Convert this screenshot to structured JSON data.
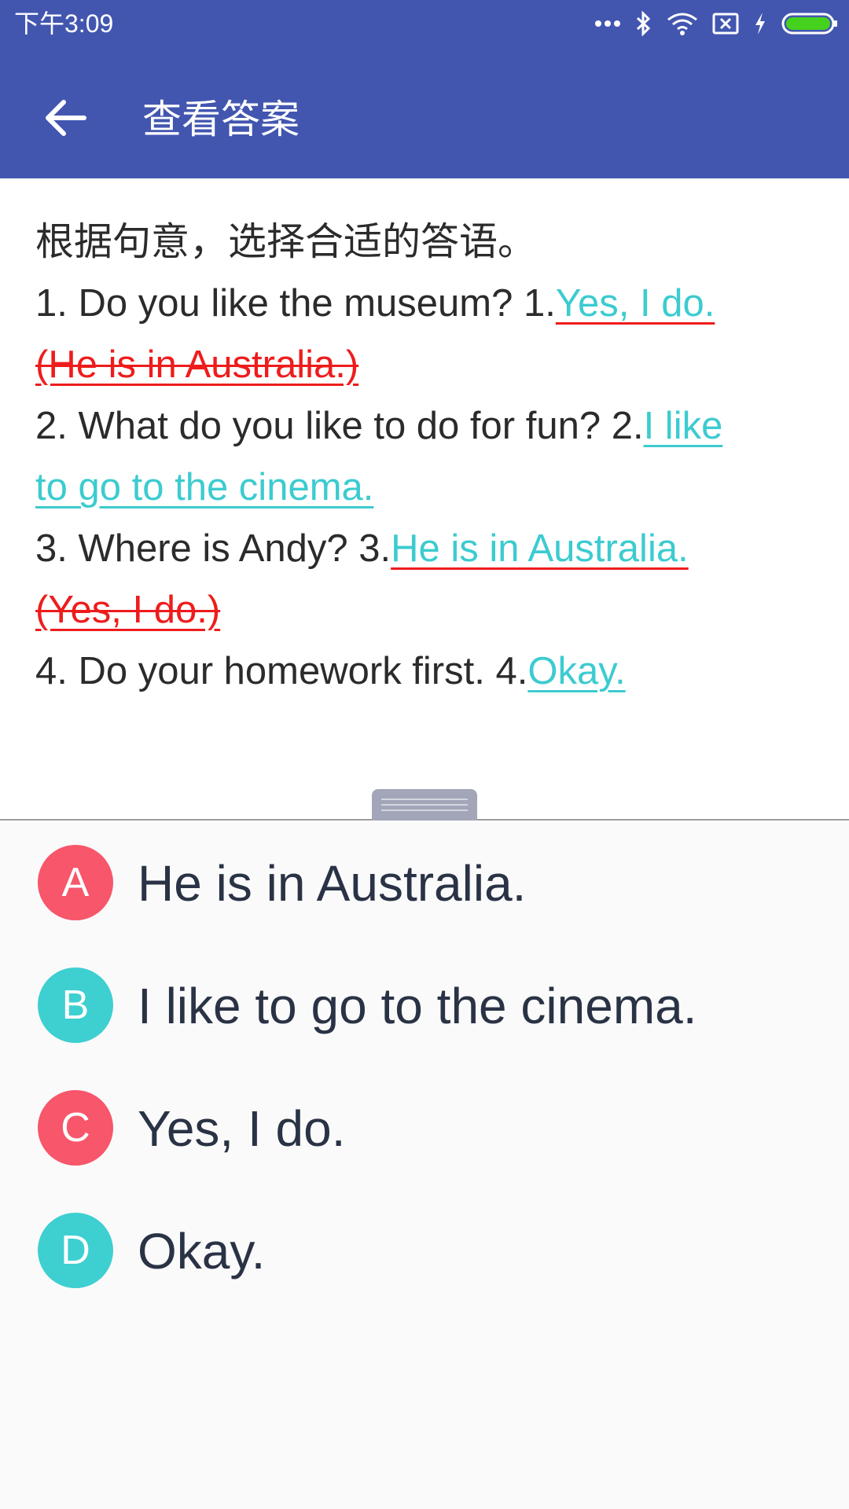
{
  "status_bar": {
    "time": "下午3:09",
    "icons": [
      "more-dots-icon",
      "bluetooth-icon",
      "wifi-icon",
      "sim-off-icon",
      "charging-icon",
      "battery-icon"
    ]
  },
  "app_bar": {
    "back_icon": "arrow-back-icon",
    "title": "查看答案"
  },
  "question": {
    "instruction": "根据句意，选择合适的答语。",
    "items": [
      {
        "prompt": "1. Do you like the museum? 1.",
        "answer_part1": "Yes, I do.",
        "wrong_answer": "(He is in Australia.)",
        "status": "wrong"
      },
      {
        "prompt": "2. What do you like to do for fun? 2.",
        "answer_part1": "I like",
        "answer_part2": "to go to the cinema.",
        "status": "correct"
      },
      {
        "prompt": "3. Where is Andy? 3.",
        "answer_part1": "He is in Australia.",
        "wrong_answer": "(Yes, I do.)",
        "status": "wrong"
      },
      {
        "prompt": "4. Do your homework first. 4.",
        "answer_part1": "Okay.",
        "status": "correct"
      }
    ]
  },
  "options": [
    {
      "letter": "A",
      "text": "He is in Australia.",
      "color": "#f7566b"
    },
    {
      "letter": "B",
      "text": "I like to go to the cinema.",
      "color": "#3ecfd1"
    },
    {
      "letter": "C",
      "text": "Yes, I do.",
      "color": "#f7566b"
    },
    {
      "letter": "D",
      "text": "Okay.",
      "color": "#3ecfd1"
    }
  ],
  "colors": {
    "app_bar": "#4256b0",
    "answer": "#3ccbd0",
    "wrong": "#ee1c1c",
    "option_text": "#2a3345"
  }
}
